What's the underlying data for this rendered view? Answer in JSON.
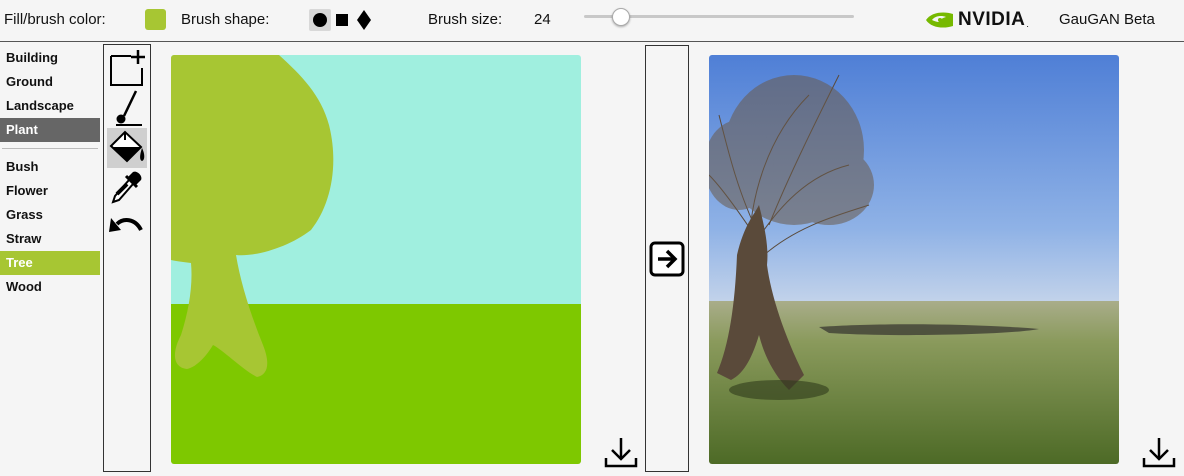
{
  "toolbar": {
    "fill_color_label": "Fill/brush color:",
    "fill_color": "#a7c633",
    "brush_shape_label": "Brush shape:",
    "brush_shapes": [
      "circle",
      "square",
      "diamond"
    ],
    "selected_shape": "circle",
    "brush_size_label": "Brush size:",
    "brush_size_value": "24",
    "brush_size_fraction": 0.12,
    "brand": "NVIDIA",
    "app_title": "GauGAN Beta"
  },
  "labels": {
    "group1": [
      {
        "label": "Building"
      },
      {
        "label": "Ground"
      },
      {
        "label": "Landscape"
      },
      {
        "label": "Plant",
        "state": "selected-category"
      }
    ],
    "group2": [
      {
        "label": "Bush"
      },
      {
        "label": "Flower"
      },
      {
        "label": "Grass"
      },
      {
        "label": "Straw"
      },
      {
        "label": "Tree",
        "state": "selected"
      },
      {
        "label": "Wood"
      }
    ]
  },
  "tools": [
    {
      "icon": "new-canvas-icon"
    },
    {
      "icon": "brush-icon"
    },
    {
      "icon": "paint-bucket-icon",
      "active": true
    },
    {
      "icon": "eyedropper-icon"
    },
    {
      "icon": "undo-icon"
    }
  ],
  "colors": {
    "sky_segment": "#a0efdf",
    "ground_segment": "#7ec800",
    "tree_segment": "#a7c633",
    "label_selected_gray": "#666666",
    "label_selected_green": "#a7c633",
    "nvidia_green": "#76b900"
  }
}
